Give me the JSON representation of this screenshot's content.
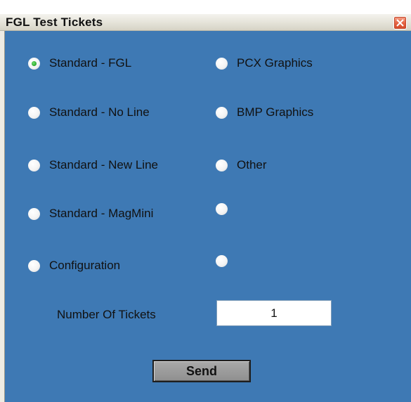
{
  "window": {
    "title": "FGL Test Tickets",
    "close_icon": "close-icon"
  },
  "colors": {
    "panel_background": "#3e79b4",
    "radio_selected_dot": "#29a629",
    "close_button": "#e4603f"
  },
  "radio_options": [
    {
      "label": "Standard - FGL",
      "selected": true
    },
    {
      "label": "Standard - No Line",
      "selected": false
    },
    {
      "label": "Standard - New Line",
      "selected": false
    },
    {
      "label": "Standard - MagMini",
      "selected": false
    },
    {
      "label": "Configuration",
      "selected": false
    },
    {
      "label": "PCX Graphics",
      "selected": false
    },
    {
      "label": "BMP Graphics",
      "selected": false
    },
    {
      "label": "Other",
      "selected": false
    },
    {
      "label": "",
      "selected": false
    },
    {
      "label": "",
      "selected": false
    }
  ],
  "tickets": {
    "label": "Number Of Tickets",
    "value": "1"
  },
  "send": {
    "label": "Send"
  }
}
